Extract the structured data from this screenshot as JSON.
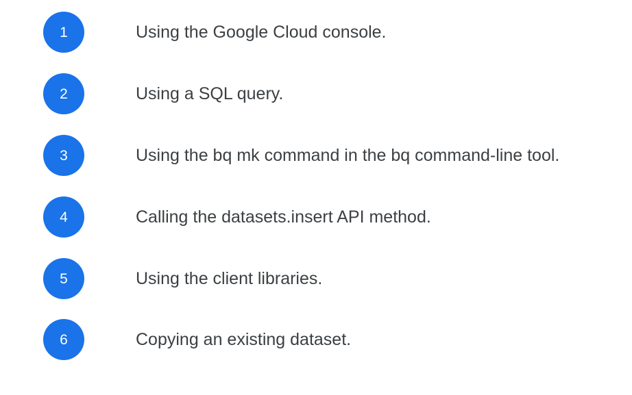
{
  "items": [
    {
      "number": "1",
      "text": "Using the Google Cloud console."
    },
    {
      "number": "2",
      "text": "Using a SQL query."
    },
    {
      "number": "3",
      "text": "Using the bq mk command in the bq command-line tool."
    },
    {
      "number": "4",
      "text": "Calling the datasets.insert API method."
    },
    {
      "number": "5",
      "text": "Using the client libraries."
    },
    {
      "number": "6",
      "text": "Copying an existing dataset."
    }
  ],
  "colors": {
    "badge_background": "#1a73e8",
    "badge_text": "#ffffff",
    "item_text": "#3c4043",
    "page_background": "#ffffff"
  }
}
